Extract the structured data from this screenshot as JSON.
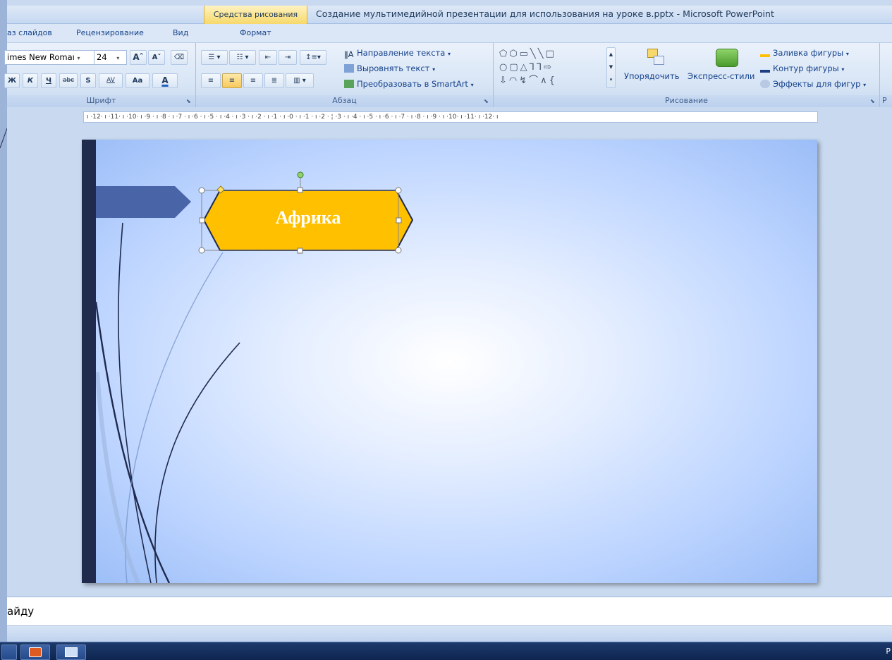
{
  "window": {
    "contextual_tab": "Средства рисования",
    "title": "Создание мультимедийной презентации для использования на уроке в.pptx - Microsoft PowerPoint"
  },
  "tabs": [
    "аз слайдов",
    "Рецензирование",
    "Вид",
    "Формат"
  ],
  "font_group": {
    "font_name": "imes New Romaı",
    "font_size": "24",
    "grow": "Aˆ",
    "shrink": "Aˇ",
    "bold": "Ж",
    "italic": "К",
    "underline": "Ч",
    "strike": "abc",
    "shadow": "S",
    "spacing": "AV",
    "case": "Aa",
    "color": "A",
    "label": "Шрифт"
  },
  "paragraph_group": {
    "text_direction": "Направление текста",
    "align_text": "Выровнять текст",
    "smartart": "Преобразовать в SmartArt",
    "label": "Абзац"
  },
  "drawing_group": {
    "arrange": "Упорядочить",
    "quick_styles": "Экспресс-стили",
    "shape_fill": "Заливка фигуры",
    "shape_outline": "Контур фигуры",
    "shape_effects": "Эффекты для фигур",
    "label": "Рисование"
  },
  "next_group_label": "Р",
  "ruler": "ı ·12· ı ·11· ı ·10· ı ·9 · ı ·8 · ı ·7 · ı ·6 · ı ·5 · ı ·4 · ı ·3 · ı ·2 · ı ·1 · ı ·0 · ı ·1 · ı ·2 · ¦ ·3 · ı ·4 · ı ·5 · ı ·6 · ı ·7 · ı ·8 · ı ·9 · ı ·10· ı ·11· ı ·12· ı",
  "slide": {
    "shape_text": "Африка"
  },
  "notes": "айду",
  "status_right": "Р",
  "colors": {
    "shape_fill": "#ffc000",
    "side_bar": "#1f2a4d",
    "arrow": "#4a64a8"
  }
}
